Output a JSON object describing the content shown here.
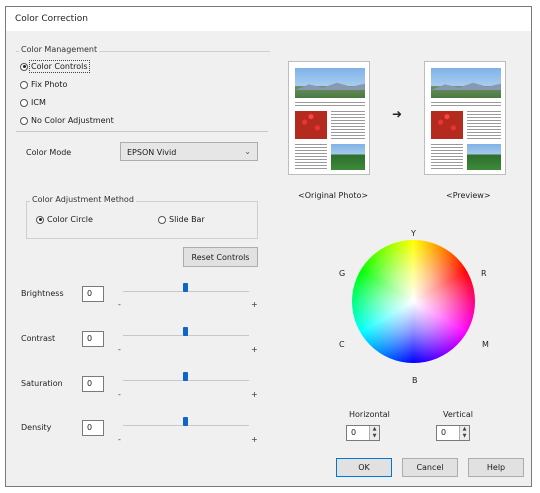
{
  "window": {
    "title": "Color Correction"
  },
  "color_management": {
    "legend": "Color Management",
    "options": [
      {
        "label": "Color Controls",
        "selected": true
      },
      {
        "label": "Fix Photo",
        "selected": false
      },
      {
        "label": "ICM",
        "selected": false
      },
      {
        "label": "No Color Adjustment",
        "selected": false
      }
    ]
  },
  "color_mode": {
    "label": "Color Mode",
    "value": "EPSON Vivid"
  },
  "adjustment_method": {
    "legend": "Color Adjustment Method",
    "options": [
      {
        "label": "Color Circle",
        "selected": true
      },
      {
        "label": "Slide Bar",
        "selected": false
      }
    ]
  },
  "reset_controls_label": "Reset Controls",
  "sliders": [
    {
      "label": "Brightness",
      "value": "0",
      "level": 0.5,
      "minus": "-",
      "plus": "+"
    },
    {
      "label": "Contrast",
      "value": "0",
      "level": 0.5,
      "minus": "-",
      "plus": "+"
    },
    {
      "label": "Saturation",
      "value": "0",
      "level": 0.5,
      "minus": "-",
      "plus": "+"
    },
    {
      "label": "Density",
      "value": "0",
      "level": 0.5,
      "minus": "-",
      "plus": "+"
    }
  ],
  "preview": {
    "original_label": "<Original Photo>",
    "preview_label": "<Preview>",
    "arrow_icon": "arrow-right-icon"
  },
  "color_circle": {
    "Y": "Y",
    "R": "R",
    "M": "M",
    "B": "B",
    "C": "C",
    "G": "G"
  },
  "horizontal": {
    "label": "Horizontal",
    "value": "0"
  },
  "vertical": {
    "label": "Vertical",
    "value": "0"
  },
  "buttons": {
    "ok": "OK",
    "cancel": "Cancel",
    "help": "Help"
  },
  "colors": {
    "slider_thumb": "#0a66c8",
    "default_button_border": "#0078d7"
  }
}
